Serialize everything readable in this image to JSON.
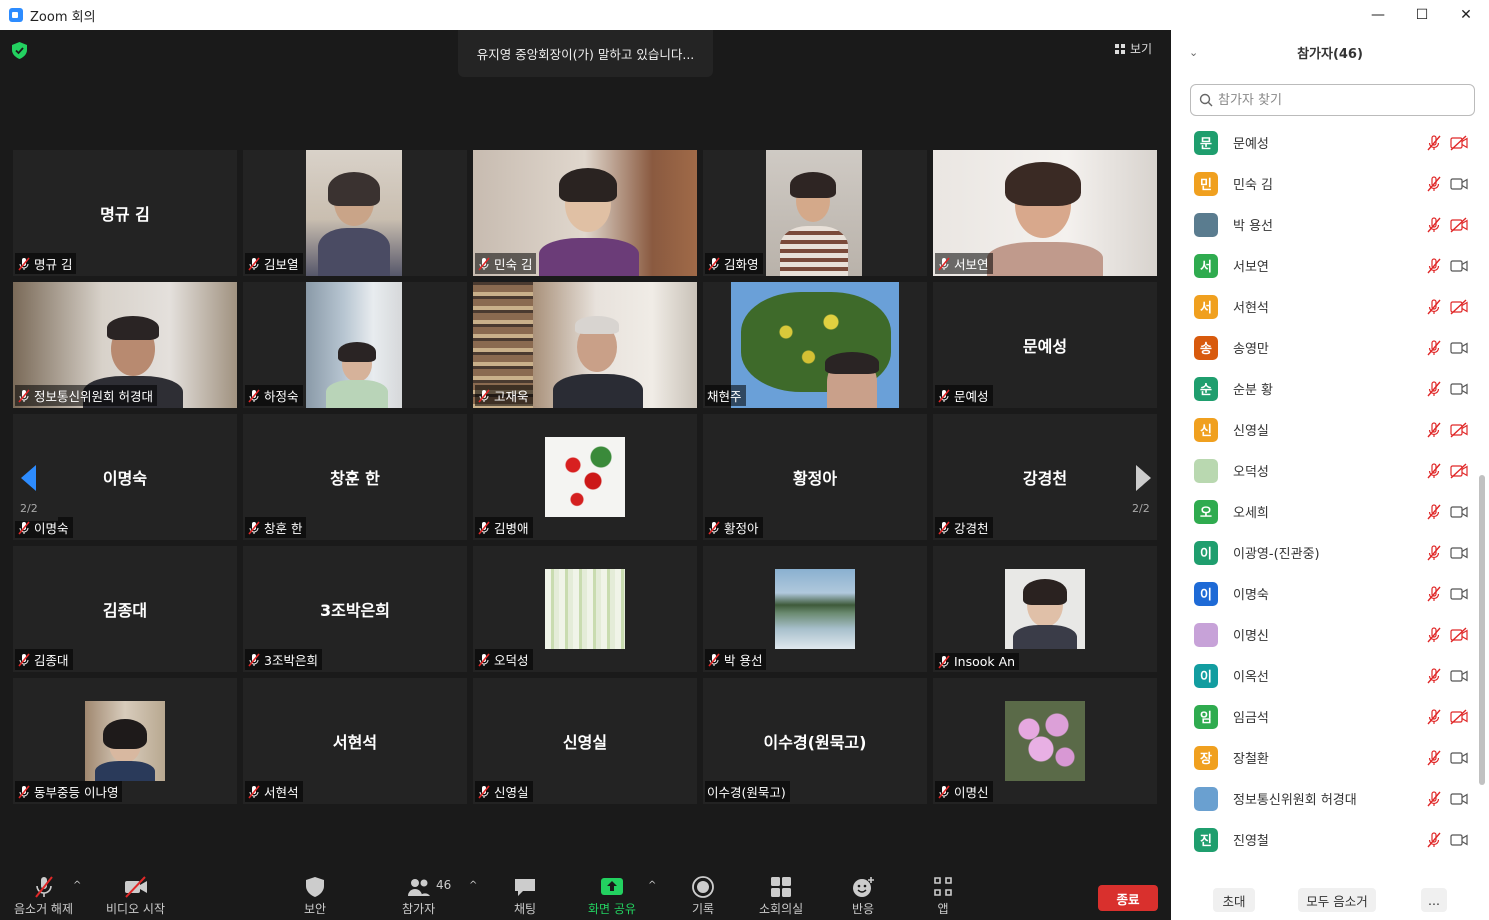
{
  "window": {
    "title": "Zoom 회의",
    "minimize": "—",
    "maximize": "☐",
    "close": "✕"
  },
  "top": {
    "speaking": "유지영  중앙회장이(가) 말하고 있습니다...",
    "view_label": "보기"
  },
  "pages": {
    "left": "2/2",
    "right": "2/2"
  },
  "tiles": [
    {
      "big": "명규 김",
      "label": "명규 김",
      "muted": true,
      "media": "none"
    },
    {
      "big": "",
      "label": "김보열",
      "muted": true,
      "media": "video-woman-glasses"
    },
    {
      "big": "",
      "label": "민숙 김",
      "muted": true,
      "media": "video-woman-smile"
    },
    {
      "big": "",
      "label": "김화영",
      "muted": true,
      "media": "video-woman-striped"
    },
    {
      "big": "",
      "label": "서보연",
      "muted": true,
      "media": "video-woman-bright"
    },
    {
      "big": "",
      "label": "정보통신위원회 허경대",
      "muted": true,
      "media": "video-man-glasses"
    },
    {
      "big": "",
      "label": "하정숙",
      "muted": true,
      "media": "video-woman-window"
    },
    {
      "big": "",
      "label": "고재욱",
      "muted": true,
      "media": "video-man-bookshelf"
    },
    {
      "big": "",
      "label": "채현주",
      "muted": false,
      "media": "video-tree-sky"
    },
    {
      "big": "문예성",
      "label": "문예성",
      "muted": true,
      "media": "none"
    },
    {
      "big": "이명숙",
      "label": "이명숙",
      "muted": true,
      "media": "none"
    },
    {
      "big": "창훈 한",
      "label": "창훈 한",
      "muted": true,
      "media": "none"
    },
    {
      "big": "",
      "label": "김병애",
      "muted": true,
      "media": "thumb-red-flowers"
    },
    {
      "big": "황정아",
      "label": "황정아",
      "muted": true,
      "media": "none"
    },
    {
      "big": "강경천",
      "label": "강경천",
      "muted": true,
      "media": "none"
    },
    {
      "big": "김종대",
      "label": "김종대",
      "muted": true,
      "media": "none"
    },
    {
      "big": "3조박은희",
      "label": "3조박은희",
      "muted": true,
      "media": "none"
    },
    {
      "big": "",
      "label": "오덕성",
      "muted": true,
      "media": "thumb-green-forest"
    },
    {
      "big": "",
      "label": "박 용선",
      "muted": true,
      "media": "thumb-lake"
    },
    {
      "big": "",
      "label": "Insook An",
      "muted": true,
      "media": "thumb-portrait"
    },
    {
      "big": "",
      "label": "동부중등 이나영",
      "muted": true,
      "media": "thumb-woman"
    },
    {
      "big": "서현석",
      "label": "서현석",
      "muted": true,
      "media": "none"
    },
    {
      "big": "신영실",
      "label": "신영실",
      "muted": true,
      "media": "none"
    },
    {
      "big": "이수경(원묵고)",
      "label": "이수경(원묵고)",
      "muted": false,
      "media": "none"
    },
    {
      "big": "",
      "label": "이명신",
      "muted": true,
      "media": "thumb-pink-flowers"
    }
  ],
  "toolbar": {
    "mute": "음소거 해제",
    "video": "비디오 시작",
    "security": "보안",
    "participants": "참가자",
    "participants_count": "46",
    "chat": "채팅",
    "share": "화면 공유",
    "record": "기록",
    "breakout": "소회의실",
    "reactions": "반응",
    "apps": "앱",
    "end": "종료"
  },
  "panel": {
    "title": "참가자(46)",
    "search_placeholder": "참가자 찾기",
    "participants": [
      {
        "avatar": "문",
        "color": "#1f9e6e",
        "name": "문예성",
        "video_off": true
      },
      {
        "avatar": "민",
        "color": "#f0a01f",
        "name": "민숙 김",
        "video_off": false
      },
      {
        "avatar": "",
        "color": "#5a7c8f",
        "name": "박 용선",
        "video_off": true
      },
      {
        "avatar": "서",
        "color": "#2fab4f",
        "name": "서보연",
        "video_off": false
      },
      {
        "avatar": "서",
        "color": "#f0a01f",
        "name": "서현석",
        "video_off": true
      },
      {
        "avatar": "송",
        "color": "#d85a0d",
        "name": "송영만",
        "video_off": false
      },
      {
        "avatar": "순",
        "color": "#1f9e6e",
        "name": "순분 황",
        "video_off": false
      },
      {
        "avatar": "신",
        "color": "#f0a01f",
        "name": "신영실",
        "video_off": true
      },
      {
        "avatar": "",
        "color": "#b9d8b0",
        "name": "오덕성",
        "video_off": true
      },
      {
        "avatar": "오",
        "color": "#2fab4f",
        "name": "오세희",
        "video_off": false
      },
      {
        "avatar": "이",
        "color": "#1f9e6e",
        "name": "이광영-(진관중)",
        "video_off": false
      },
      {
        "avatar": "이",
        "color": "#1e6ad6",
        "name": "이명숙",
        "video_off": false
      },
      {
        "avatar": "",
        "color": "#c7a2d8",
        "name": "이명신",
        "video_off": true
      },
      {
        "avatar": "이",
        "color": "#129da0",
        "name": "이옥선",
        "video_off": false
      },
      {
        "avatar": "임",
        "color": "#2fab4f",
        "name": "임금석",
        "video_off": true
      },
      {
        "avatar": "장",
        "color": "#f0a01f",
        "name": "장철환",
        "video_off": false
      },
      {
        "avatar": "",
        "color": "#6aa0d0",
        "name": "정보통신위원회 허경대",
        "video_off": false
      },
      {
        "avatar": "진",
        "color": "#1f9e6e",
        "name": "진영철",
        "video_off": false
      }
    ],
    "invite": "초대",
    "mute_all": "모두 음소거",
    "more": "..."
  }
}
